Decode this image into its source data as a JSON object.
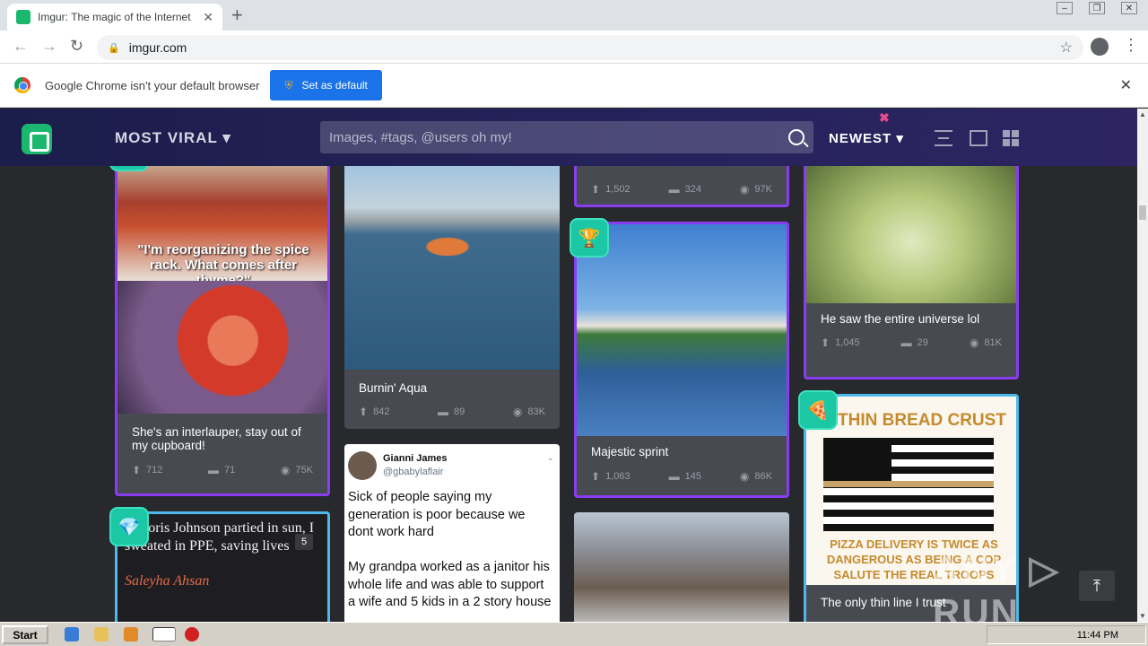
{
  "browser": {
    "tab_title": "Imgur: The magic of the Internet",
    "tab_close": "✕",
    "new_tab": "+",
    "url": "imgur.com",
    "infobar_text": "Google Chrome isn't your default browser",
    "set_default_label": "Set as default",
    "infobar_close": "✕"
  },
  "imgur": {
    "section_label": "MOST VIRAL ▾",
    "search_placeholder": "Images, #tags, @users oh my!",
    "sort_label": "NEWEST ▾"
  },
  "posts": [
    {
      "title": "She's an interlauper, stay out of my cupboard!",
      "image_caption": "\"I'm reorganizing the spice rack. What comes after thyme?\"",
      "upvotes": "712",
      "comments": "71",
      "views": "75K"
    },
    {
      "title": "Burnin' Aqua",
      "upvotes": "842",
      "comments": "89",
      "views": "83K"
    },
    {
      "title": "",
      "upvotes": "1,502",
      "comments": "324",
      "views": "97K"
    },
    {
      "title": "Majestic sprint",
      "upvotes": "1,063",
      "comments": "145",
      "views": "86K"
    },
    {
      "title": "He saw the entire universe lol",
      "upvotes": "1,045",
      "comments": "29",
      "views": "81K"
    },
    {
      "title": "The only thin line I trust",
      "image_text_top": "E THIN BREAD CRUST",
      "image_text_bottom": "PIZZA DELIVERY IS TWICE AS DANGEROUS AS BEING A COP SALUTE THE REAL TROOPS"
    },
    {
      "quote": "le Boris Johnson partied in sun, I sweated in PPE, saving lives",
      "author": "Saleyha Ahsan",
      "count": "5"
    }
  ],
  "tweet": {
    "name": "Gianni James",
    "handle": "@gbabylaflair",
    "text1": "Sick of people saying my generation is poor because we dont work hard",
    "text2": "My grandpa worked as a janitor his whole life and was able to support a wife and 5 kids in a 2 story house"
  },
  "taskbar": {
    "start": "Start",
    "time": "11:44 PM"
  },
  "watermark": "ANY ▷ RUN"
}
